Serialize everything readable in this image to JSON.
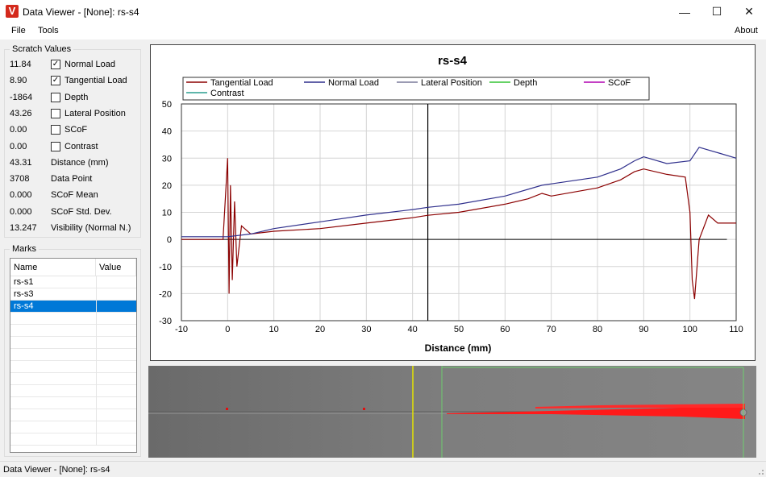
{
  "window": {
    "title": "Data Viewer - [None]: rs-s4",
    "app_icon_letter": "V",
    "minimize": "—",
    "maximize": "☐",
    "close": "✕"
  },
  "menu": {
    "file": "File",
    "tools": "Tools",
    "about": "About"
  },
  "scratch_values": {
    "title": "Scratch Values",
    "rows": [
      {
        "value": "11.84",
        "label": "Normal Load",
        "has_checkbox": true,
        "checked": true
      },
      {
        "value": "8.90",
        "label": "Tangential Load",
        "has_checkbox": true,
        "checked": true
      },
      {
        "value": "-1864",
        "label": "Depth",
        "has_checkbox": true,
        "checked": false
      },
      {
        "value": "43.26",
        "label": "Lateral Position",
        "has_checkbox": true,
        "checked": false
      },
      {
        "value": "0.00",
        "label": "SCoF",
        "has_checkbox": true,
        "checked": false
      },
      {
        "value": "0.00",
        "label": "Contrast",
        "has_checkbox": true,
        "checked": false
      },
      {
        "value": "43.31",
        "label": "Distance (mm)",
        "has_checkbox": false
      },
      {
        "value": "3708",
        "label": "Data Point",
        "has_checkbox": false
      },
      {
        "value": "0.000",
        "label": "SCoF Mean",
        "has_checkbox": false
      },
      {
        "value": "0.000",
        "label": "SCoF Std. Dev.",
        "has_checkbox": false
      },
      {
        "value": "13.247",
        "label": "Visibility (Normal N.)",
        "has_checkbox": false
      }
    ]
  },
  "marks": {
    "title": "Marks",
    "columns": [
      "Name",
      "Value"
    ],
    "items": [
      {
        "name": "rs-s1",
        "value": ""
      },
      {
        "name": "rs-s3",
        "value": ""
      },
      {
        "name": "rs-s4",
        "value": "",
        "selected": true
      }
    ]
  },
  "chart_data": {
    "type": "line",
    "title": "rs-s4",
    "xlabel": "Distance (mm)",
    "ylabel": "",
    "xlim": [
      -10,
      110
    ],
    "ylim": [
      -30,
      50
    ],
    "x_ticks": [
      "-10",
      "0",
      "10",
      "20",
      "30",
      "40",
      "50",
      "60",
      "70",
      "80",
      "90",
      "100",
      "110"
    ],
    "y_ticks": [
      "50",
      "40",
      "30",
      "20",
      "10",
      "0",
      "-10",
      "-20",
      "-30"
    ],
    "grid": true,
    "cursor_x": 43.3,
    "legend_position": "top",
    "series": [
      {
        "name": "Tangential Load",
        "color": "#8b0000",
        "x": [
          -10,
          -1,
          0,
          0.3,
          0.6,
          1,
          1.5,
          2,
          3,
          5,
          10,
          20,
          30,
          40,
          43.3,
          50,
          60,
          65,
          68,
          70,
          80,
          85,
          88,
          90,
          95,
          99,
          100,
          100.5,
          101,
          102,
          104,
          106,
          110
        ],
        "y": [
          0,
          0,
          30,
          -20,
          20,
          -15,
          14,
          -10,
          5,
          2,
          3,
          4,
          6,
          8,
          8.9,
          10,
          13,
          15,
          17,
          16,
          19,
          22,
          25,
          26,
          24,
          23,
          10,
          -15,
          -22,
          0,
          9,
          6,
          6
        ]
      },
      {
        "name": "Normal Load",
        "color": "#2f2f8c",
        "x": [
          -10,
          0,
          5,
          10,
          20,
          30,
          40,
          43.3,
          50,
          60,
          68,
          70,
          80,
          85,
          88,
          90,
          95,
          100,
          102,
          106,
          110
        ],
        "y": [
          1,
          1,
          2,
          4,
          6.5,
          9,
          11,
          11.84,
          13,
          16,
          20,
          20.5,
          23,
          26,
          29,
          30.5,
          28,
          29,
          34,
          32,
          30
        ]
      },
      {
        "name": "Lateral Position",
        "color": "#7a7a9a",
        "x": [],
        "y": []
      },
      {
        "name": "Depth",
        "color": "#34c334",
        "x": [],
        "y": []
      },
      {
        "name": "SCoF",
        "color": "#b000b0",
        "x": [],
        "y": []
      },
      {
        "name": "Contrast",
        "color": "#2a9d8f",
        "x": [],
        "y": []
      }
    ]
  },
  "status": {
    "text": "Data Viewer - [None]: rs-s4"
  }
}
